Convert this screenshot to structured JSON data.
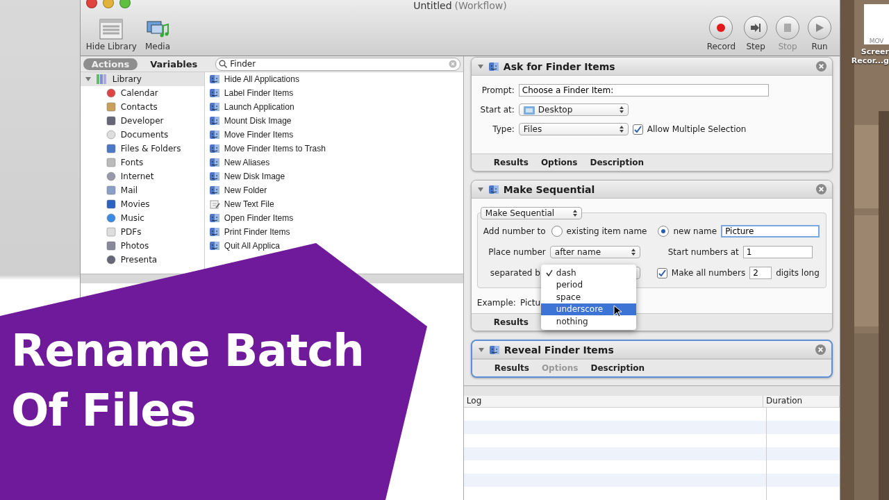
{
  "window": {
    "title": "Untitled",
    "subtitle": "(Workflow)"
  },
  "toolbar": {
    "left": [
      {
        "label": "Hide Library",
        "kind": "library"
      },
      {
        "label": "Media",
        "kind": "media"
      }
    ],
    "right": [
      {
        "label": "Record",
        "kind": "record",
        "disabled": false
      },
      {
        "label": "Step",
        "kind": "step",
        "disabled": false
      },
      {
        "label": "Stop",
        "kind": "stop",
        "disabled": true
      },
      {
        "label": "Run",
        "kind": "run",
        "disabled": false
      }
    ]
  },
  "library": {
    "tabs": [
      {
        "label": "Actions",
        "selected": true
      },
      {
        "label": "Variables",
        "selected": false
      }
    ],
    "search": {
      "value": "Finder"
    },
    "root": {
      "label": "Library",
      "expanded": true,
      "children": [
        {
          "label": "Calendar"
        },
        {
          "label": "Contacts"
        },
        {
          "label": "Developer"
        },
        {
          "label": "Documents"
        },
        {
          "label": "Files & Folders"
        },
        {
          "label": "Fonts"
        },
        {
          "label": "Internet"
        },
        {
          "label": "Mail"
        },
        {
          "label": "Movies"
        },
        {
          "label": "Music"
        },
        {
          "label": "PDFs"
        },
        {
          "label": "Photos"
        },
        {
          "label": "Presenta"
        }
      ]
    },
    "actions": [
      {
        "label": "Hide All Applications",
        "kind": "finder"
      },
      {
        "label": "Label Finder Items",
        "kind": "finder"
      },
      {
        "label": "Launch Application",
        "kind": "finder"
      },
      {
        "label": "Mount Disk Image",
        "kind": "finder"
      },
      {
        "label": "Move Finder Items",
        "kind": "finder"
      },
      {
        "label": "Move Finder Items to Trash",
        "kind": "finder"
      },
      {
        "label": "New Aliases",
        "kind": "finder"
      },
      {
        "label": "New Disk Image",
        "kind": "finder"
      },
      {
        "label": "New Folder",
        "kind": "finder"
      },
      {
        "label": "New Text File",
        "kind": "text"
      },
      {
        "label": "Open Finder Items",
        "kind": "finder"
      },
      {
        "label": "Print Finder Items",
        "kind": "finder"
      },
      {
        "label": "Quit All Applica",
        "kind": "finder"
      }
    ]
  },
  "workflow": {
    "cards": [
      {
        "kind": "ask",
        "title": "Ask for Finder Items",
        "selected": false,
        "prompt_label": "Prompt:",
        "prompt_value": "Choose a Finder Item:",
        "start_label": "Start at:",
        "start_value": "Desktop",
        "type_label": "Type:",
        "type_value": "Files",
        "allow_multiple": {
          "label": "Allow Multiple Selection",
          "checked": true
        },
        "tabs": [
          {
            "label": "Results",
            "disabled": false
          },
          {
            "label": "Options",
            "disabled": false
          },
          {
            "label": "Description",
            "disabled": false
          }
        ]
      },
      {
        "kind": "sequential",
        "title": "Make Sequential",
        "selected": false,
        "mode_value": "Make Sequential",
        "add_label": "Add number to",
        "radios": [
          {
            "label": "existing item name",
            "selected": false
          },
          {
            "label": "new name",
            "selected": true
          }
        ],
        "new_name_value": "Picture",
        "place_label": "Place number",
        "place_value": "after name",
        "start_label": "Start numbers at",
        "start_value": "1",
        "separator_label": "separated b",
        "make_all": {
          "label": "Make all numbers",
          "checked": true
        },
        "digits_value": "2",
        "digits_suffix": "digits long",
        "example_label": "Example:",
        "example_value": "Pictu",
        "tabs": [
          {
            "label": "Results",
            "disabled": false
          }
        ],
        "menu": [
          {
            "label": "dash",
            "checked": true,
            "selected": false
          },
          {
            "label": "period",
            "checked": false,
            "selected": false
          },
          {
            "label": "space",
            "checked": false,
            "selected": false
          },
          {
            "label": "underscore",
            "checked": false,
            "selected": true
          },
          {
            "label": "nothing",
            "checked": false,
            "selected": false
          }
        ]
      },
      {
        "kind": "reveal",
        "title": "Reveal Finder Items",
        "selected": true,
        "tabs": [
          {
            "label": "Results",
            "disabled": false
          },
          {
            "label": "Options",
            "disabled": true
          },
          {
            "label": "Description",
            "disabled": false
          }
        ]
      }
    ]
  },
  "log": {
    "columns": [
      "Log",
      "Duration"
    ]
  },
  "desktop": {
    "badge": "MOV",
    "label_lines": [
      "Screer",
      "Recor...g"
    ]
  },
  "banner": {
    "lines": [
      "Rename Batch",
      "Of Files"
    ]
  }
}
